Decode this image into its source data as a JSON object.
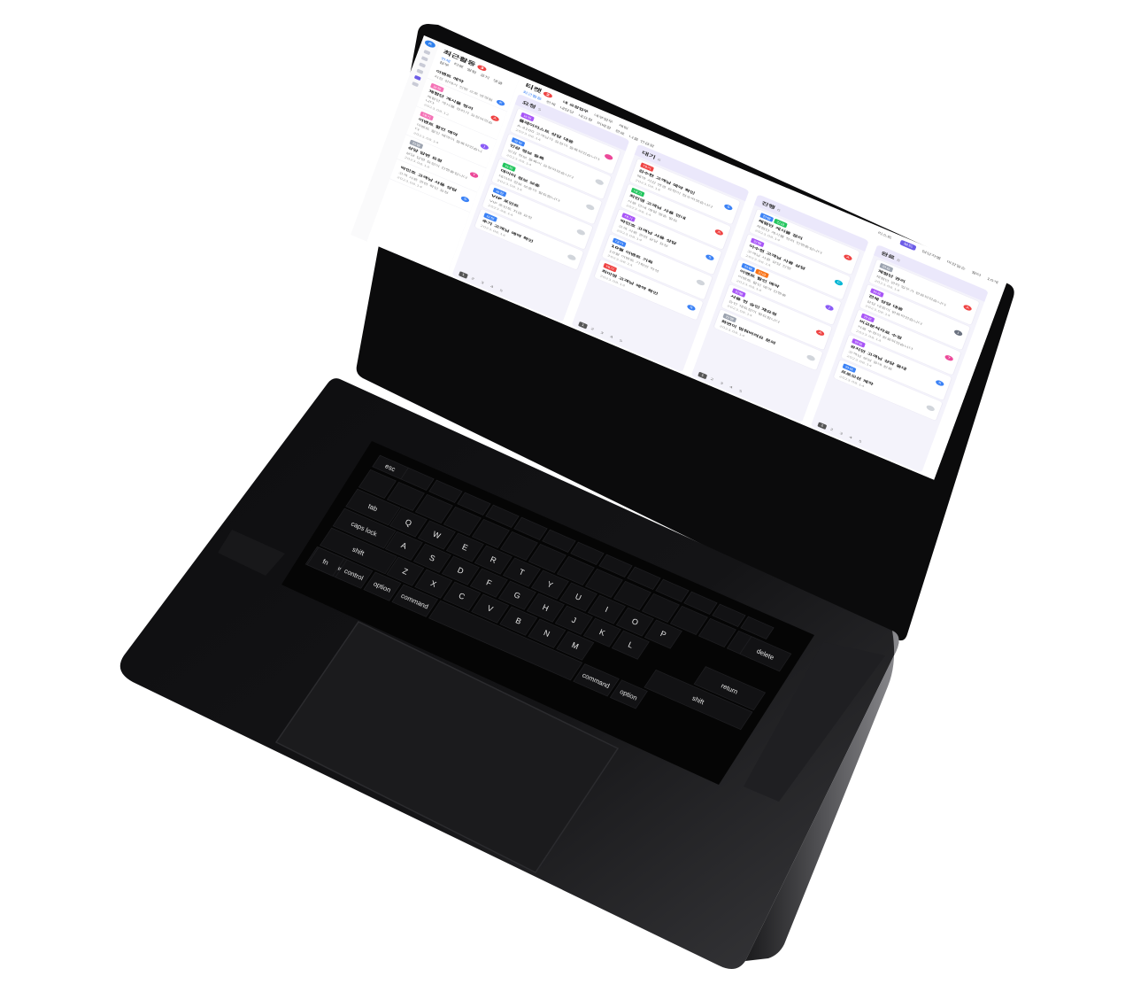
{
  "rail": {
    "avatar": "R"
  },
  "activity": {
    "title": "최근활동",
    "badge": "3",
    "filters": [
      "전체",
      "티켓",
      "알림",
      "공지",
      "댓글",
      "첨부"
    ],
    "items": [
      {
        "tag": "",
        "title": "이벤트 예약",
        "desc": "지정 상태가 진행 으로 변경됨",
        "date": "",
        "avatar": "K",
        "tag_color": "#60a5fa",
        "avatar_color": "#3b82f6"
      },
      {
        "tag": "요청",
        "title": "체험단 게시물 정리",
        "desc": "체험단 게시물 정리가 요청되었습니다",
        "date": "2023.08.12",
        "avatar": "A",
        "tag_color": "#f472b6",
        "avatar_color": "#ef4444"
      },
      {
        "tag": "대기",
        "title": "이벤트 할인 예약",
        "desc": "이벤트 할인 예약이 등록되었습니다",
        "date": "2023.08.14",
        "avatar": "J",
        "tag_color": "#f472b6",
        "avatar_color": "#8b5cf6"
      },
      {
        "tag": "진행",
        "title": "상담 답변 요청",
        "desc": "상담 답변 요청이 진행중입니다",
        "date": "2023.08.14",
        "avatar": "T",
        "tag_color": "#9ca3af",
        "avatar_color": "#ec4899"
      },
      {
        "tag": "",
        "title": "박민호 고객님 사용 상담",
        "desc": "고객 사용 관련 확인 요청",
        "date": "2023.08.14",
        "avatar": "S",
        "tag_color": "#60a5fa",
        "avatar_color": "#3b82f6"
      }
    ]
  },
  "board": {
    "title": "티켓",
    "badge": "2",
    "tabs": [
      "내 요청업무",
      "내부업무",
      "채팅"
    ],
    "filters": [
      "최근활동",
      "전체",
      "내담당",
      "내요청",
      "미배정",
      "완료",
      "나를 언급함"
    ],
    "toolbar": {
      "view_list": "리스트",
      "view_board": "보드",
      "assignee": "담당자별",
      "sort": "마감일순",
      "more": "필터",
      "count": "10개"
    },
    "columns": [
      {
        "title": "요청",
        "count": "5",
        "cards": [
          {
            "tags": [
              {
                "text": "요청",
                "color": "#a855f7"
              }
            ],
            "title": "플레이리스트 상담 대응",
            "desc": "A-4100 고객님의 요청이 등록되었습니다",
            "meta": "2023.08.14",
            "avatar": "",
            "avatar_color": "#ec4899"
          },
          {
            "tags": [
              {
                "text": "요청",
                "color": "#3b82f6"
              }
            ],
            "title": "인감 정보 등록",
            "desc": "인감 정보 등록이 요청되었습니다",
            "meta": "2023.08.14",
            "avatar": "",
            "avatar_color": "#d1d5db"
          },
          {
            "tags": [
              {
                "text": "요청",
                "color": "#22c55e"
              }
            ],
            "title": "데이터 정보 보충",
            "desc": "데이터 정보 보충이 필요합니다",
            "meta": "2023.08.14",
            "avatar": "",
            "avatar_color": "#d1d5db"
          },
          {
            "tags": [
              {
                "text": "요청",
                "color": "#3b82f6"
              }
            ],
            "title": "VIP 포인트",
            "desc": "VIP 포인트 지급 요청",
            "meta": "2023.08.14",
            "avatar": "",
            "avatar_color": "#d1d5db"
          },
          {
            "tags": [
              {
                "text": "요청",
                "color": "#3b82f6"
              }
            ],
            "title": "추가 고객님 예약 확인",
            "desc": "",
            "meta": "2023.08.14",
            "avatar": "",
            "avatar_color": "#d1d5db"
          }
        ]
      },
      {
        "title": "대기",
        "count": "6",
        "cards": [
          {
            "tags": [
              {
                "text": "대기",
                "color": "#ef4444"
              }
            ],
            "title": "김수한 고객님 예약 확인",
            "desc": "예약 시간 변경 요청이 접수되었습니다",
            "meta": "2023.08.14",
            "avatar": "S",
            "avatar_color": "#3b82f6"
          },
          {
            "tags": [
              {
                "text": "대기",
                "color": "#22c55e"
              }
            ],
            "title": "최민영 고객님 사용 안내",
            "desc": "사용 안내 메일 발송 필요",
            "meta": "2023.08.14",
            "avatar": "A",
            "avatar_color": "#ef4444"
          },
          {
            "tags": [
              {
                "text": "대기",
                "color": "#a855f7"
              }
            ],
            "title": "박민호 고객님 사용 상담",
            "desc": "고객 사용 관련 상담 요청",
            "meta": "2023.08.14",
            "avatar": "S",
            "avatar_color": "#3b82f6"
          },
          {
            "tags": [
              {
                "text": "대기",
                "color": "#3b82f6"
              }
            ],
            "title": "10월 이벤트 기획",
            "desc": "10월 이벤트 기획안 작성",
            "meta": "2023.08.14",
            "avatar": "",
            "avatar_color": "#d1d5db"
          },
          {
            "tags": [
              {
                "text": "대기",
                "color": "#ef4444"
              }
            ],
            "title": "최미영 고객님 예약 확인",
            "desc": "",
            "meta": "2023.08.14",
            "avatar": "S",
            "avatar_color": "#3b82f6"
          }
        ]
      },
      {
        "title": "진행",
        "count": "6",
        "cards": [
          {
            "tags": [
              {
                "text": "진행",
                "color": "#3b82f6"
              },
              {
                "text": "긴급",
                "color": "#22c55e"
              }
            ],
            "title": "체험단 게시물 정리",
            "desc": "체험단 게시물 정리 진행중입니다",
            "meta": "2023.08.14",
            "avatar": "A",
            "avatar_color": "#ef4444"
          },
          {
            "tags": [
              {
                "text": "진행",
                "color": "#a855f7"
              }
            ],
            "title": "이수현 고객님 사용 상담",
            "desc": "고객님 사용 상담 진행",
            "meta": "2023.08.14",
            "avatar": "C",
            "avatar_color": "#06b6d4"
          },
          {
            "tags": [
              {
                "text": "진행",
                "color": "#3b82f6"
              },
              {
                "text": "긴급",
                "color": "#f97316"
              }
            ],
            "title": "이벤트 할인 예약",
            "desc": "이벤트 할인 예약 진행중",
            "meta": "2023.08.14",
            "avatar": "J",
            "avatar_color": "#8b5cf6"
          },
          {
            "tags": [
              {
                "text": "진행",
                "color": "#a855f7"
              }
            ],
            "title": "사용 전 승인 재요청",
            "desc": "승인 재요청이 필요합니다",
            "meta": "2023.08.14",
            "avatar": "A",
            "avatar_color": "#ef4444"
          },
          {
            "tags": [
              {
                "text": "진행",
                "color": "#9ca3af"
              }
            ],
            "title": "화면이 멈춰버려요 문의",
            "desc": "",
            "meta": "2023.08.14",
            "avatar": "",
            "avatar_color": "#d1d5db"
          }
        ]
      },
      {
        "title": "완료",
        "count": "8",
        "cards": [
          {
            "tags": [
              {
                "text": "완료",
                "color": "#9ca3af"
              }
            ],
            "title": "체험단 관리",
            "desc": "체험단 관리 업무가 완료되었습니다",
            "meta": "2023.08.14",
            "avatar": "A",
            "avatar_color": "#ef4444"
          },
          {
            "tags": [
              {
                "text": "완료",
                "color": "#a855f7"
              }
            ],
            "title": "전체 상담 대응",
            "desc": "상담 대응이 완료되었습니다",
            "meta": "2023.08.14",
            "avatar": "J",
            "avatar_color": "#6b7280"
          },
          {
            "tags": [
              {
                "text": "완료",
                "color": "#a855f7"
              }
            ],
            "title": "비교분석자료 수정",
            "desc": "자료 수정이 완료되었습니다",
            "meta": "2023.08.14",
            "avatar": "T",
            "avatar_color": "#ec4899"
          },
          {
            "tags": [
              {
                "text": "완료",
                "color": "#a855f7"
              }
            ],
            "title": "유지만 고객님 상담 응대",
            "desc": "고객님 상담 응대 완료",
            "meta": "2023.08.14",
            "avatar": "S",
            "avatar_color": "#3b82f6"
          },
          {
            "tags": [
              {
                "text": "완료",
                "color": "#3b82f6"
              }
            ],
            "title": "프로모션 제작",
            "desc": "",
            "meta": "2023.08.14",
            "avatar": "",
            "avatar_color": "#d1d5db"
          }
        ]
      }
    ],
    "pages": [
      "1",
      "2",
      "3",
      "4",
      "5"
    ]
  },
  "keyboard": {
    "keys": [
      "esc",
      "tab",
      "caps lock",
      "shift",
      "fn",
      "control",
      "option",
      "command",
      "delete",
      "return",
      "shift",
      "command",
      "option"
    ],
    "letters": [
      "Q",
      "W",
      "E",
      "R",
      "T",
      "Y",
      "U",
      "I",
      "O",
      "P",
      "A",
      "S",
      "D",
      "F",
      "G",
      "H",
      "J",
      "K",
      "L",
      "Z",
      "X",
      "C",
      "V",
      "B",
      "N",
      "M"
    ]
  }
}
